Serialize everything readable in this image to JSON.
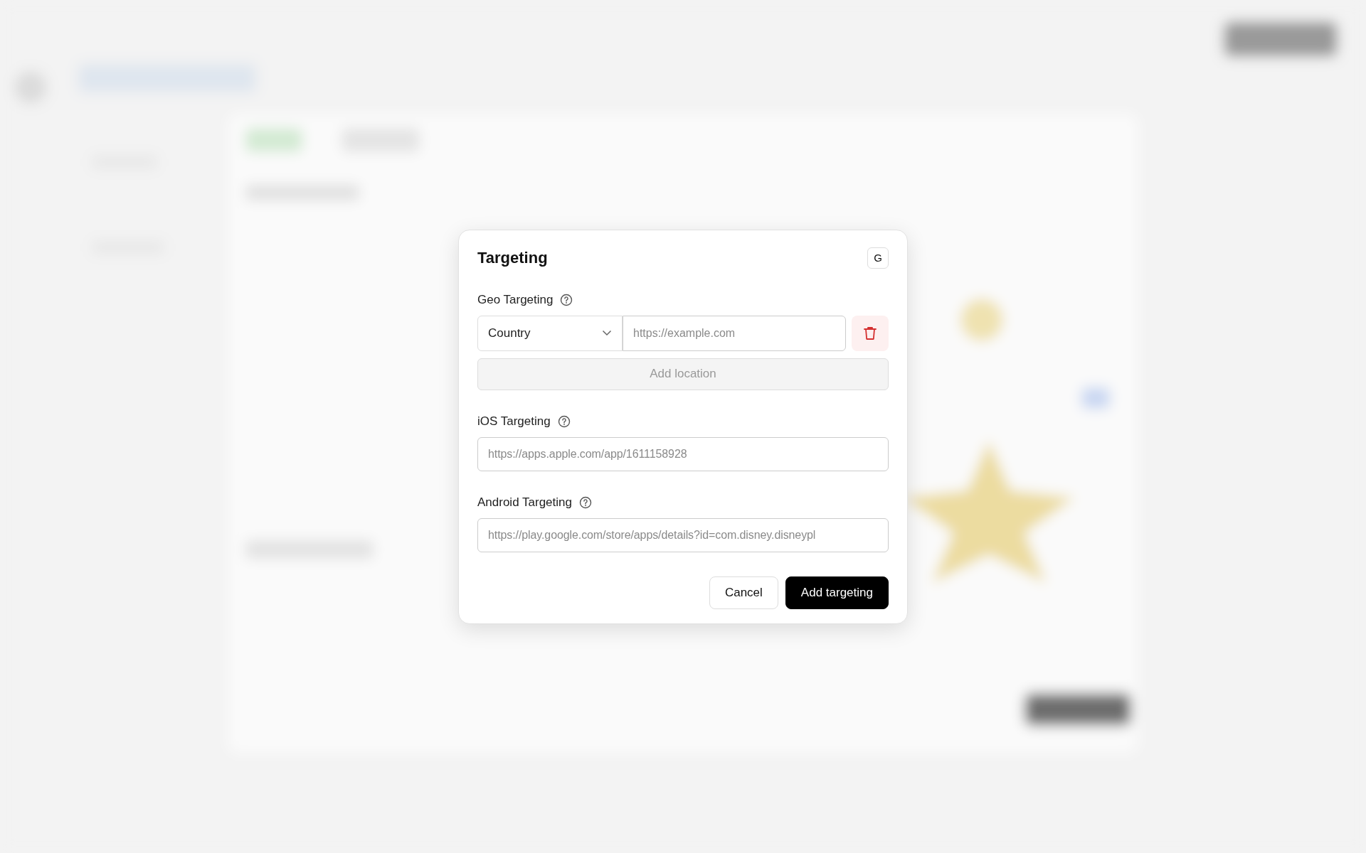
{
  "dialog": {
    "title": "Targeting",
    "shortcut_button": "G",
    "geo": {
      "label": "Geo Targeting",
      "rows": [
        {
          "select": "Country",
          "placeholder": "https://example.com"
        }
      ],
      "add_button": {
        "label": "Add location",
        "disabled": true
      }
    },
    "fields": [
      {
        "label": "iOS Targeting",
        "placeholder": "https://apps.apple.com/app/1611158928"
      },
      {
        "label": "Android Targeting",
        "placeholder": "https://play.google.com/store/apps/details?id=com.disney.disneypl"
      }
    ],
    "buttons": [
      {
        "label": "Cancel",
        "kind": "secondary"
      },
      {
        "label": "Add targeting",
        "kind": "primary"
      }
    ]
  }
}
